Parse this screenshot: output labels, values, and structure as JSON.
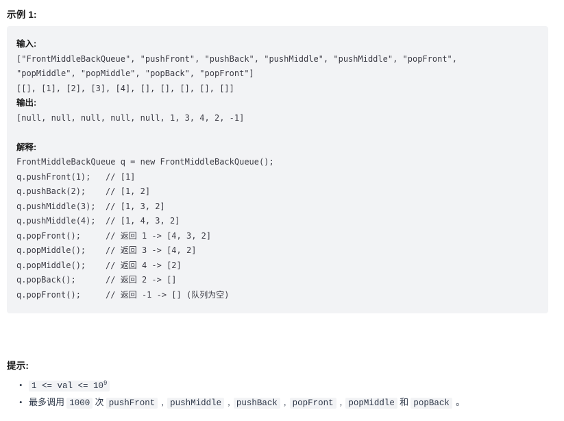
{
  "example": {
    "heading": "示例 1:",
    "lines": [
      {
        "type": "label",
        "text": "输入:"
      },
      {
        "type": "code",
        "text": "[\"FrontMiddleBackQueue\", \"pushFront\", \"pushBack\", \"pushMiddle\", \"pushMiddle\", \"popFront\","
      },
      {
        "type": "code",
        "text": "\"popMiddle\", \"popMiddle\", \"popBack\", \"popFront\"]"
      },
      {
        "type": "code",
        "text": "[[], [1], [2], [3], [4], [], [], [], [], []]"
      },
      {
        "type": "label",
        "text": "输出:"
      },
      {
        "type": "code",
        "text": "[null, null, null, null, null, 1, 3, 4, 2, -1]"
      },
      {
        "type": "blank",
        "text": ""
      },
      {
        "type": "label",
        "text": "解释:"
      },
      {
        "type": "code",
        "text": "FrontMiddleBackQueue q = new FrontMiddleBackQueue();"
      },
      {
        "type": "code",
        "text": "q.pushFront(1);   // [1]"
      },
      {
        "type": "code",
        "text": "q.pushBack(2);    // [1, 2]"
      },
      {
        "type": "code",
        "text": "q.pushMiddle(3);  // [1, 3, 2]"
      },
      {
        "type": "code",
        "text": "q.pushMiddle(4);  // [1, 4, 3, 2]"
      },
      {
        "type": "code",
        "text": "q.popFront();     // 返回 1 -> [4, 3, 2]"
      },
      {
        "type": "code",
        "text": "q.popMiddle();    // 返回 3 -> [4, 2]"
      },
      {
        "type": "code",
        "text": "q.popMiddle();    // 返回 4 -> [2]"
      },
      {
        "type": "code",
        "text": "q.popBack();      // 返回 2 -> []"
      },
      {
        "type": "code",
        "text": "q.popFront();     // 返回 -1 -> [] (队列为空)"
      }
    ]
  },
  "hints": {
    "heading": "提示:",
    "bullet_glyph": "•",
    "items": [
      {
        "parts": [
          {
            "kind": "code",
            "text": "1 <= val <= 10",
            "sup": "9"
          }
        ]
      },
      {
        "parts": [
          {
            "kind": "cn",
            "text": "最多调用"
          },
          {
            "kind": "code",
            "text": "1000"
          },
          {
            "kind": "cn",
            "text": "次"
          },
          {
            "kind": "code",
            "text": "pushFront"
          },
          {
            "kind": "sep",
            "text": ","
          },
          {
            "kind": "code",
            "text": "pushMiddle"
          },
          {
            "kind": "sep",
            "text": ","
          },
          {
            "kind": "code",
            "text": "pushBack"
          },
          {
            "kind": "sep",
            "text": ","
          },
          {
            "kind": "code",
            "text": "popFront"
          },
          {
            "kind": "sep",
            "text": ","
          },
          {
            "kind": "code",
            "text": "popMiddle"
          },
          {
            "kind": "cn",
            "text": "和"
          },
          {
            "kind": "code",
            "text": "popBack"
          },
          {
            "kind": "sep",
            "text": "。"
          }
        ]
      }
    ]
  },
  "colors": {
    "code_block_bg": "#f2f3f5",
    "page_bg": "#ffffff",
    "text": "#2d3748",
    "heading": "#1a1a1a"
  }
}
